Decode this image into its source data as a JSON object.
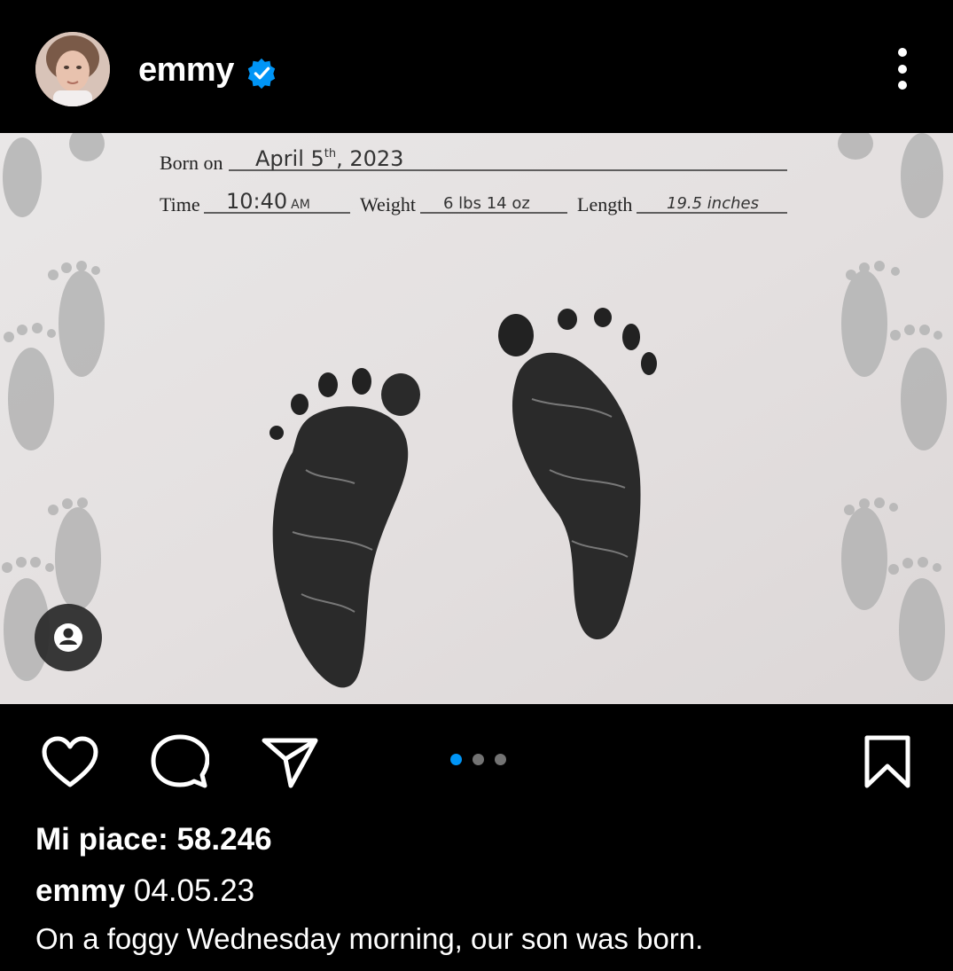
{
  "header": {
    "username": "emmy",
    "verified_icon": "verified-badge-icon",
    "more_icon": "more-vertical-icon"
  },
  "photo": {
    "form": {
      "born_on_label": "Born on",
      "born_on_value": "April 5th, 2023",
      "born_on_month_day": "April 5",
      "born_on_sup": "th",
      "born_on_year": ", 2023",
      "time_label": "Time",
      "time_value": "10:40",
      "time_ampm": "AM",
      "weight_label": "Weight",
      "weight_value": "6 lbs 14 oz",
      "length_label": "Length",
      "length_value": "19.5 inches"
    },
    "user_tag_icon": "person-icon"
  },
  "actions": {
    "like_icon": "heart-icon",
    "comment_icon": "comment-icon",
    "share_icon": "send-icon",
    "save_icon": "bookmark-icon",
    "carousel": {
      "count": 3,
      "active": 0
    }
  },
  "post": {
    "likes_text": "Mi piace: 58.246",
    "caption_user": "emmy",
    "caption_date": "04.05.23",
    "caption_text": "On a foggy Wednesday morning, our son was born."
  },
  "colors": {
    "background": "#000000",
    "text": "#ffffff",
    "verified": "#0095f6",
    "dot_active": "#0095f6",
    "dot_inactive": "#737373"
  }
}
